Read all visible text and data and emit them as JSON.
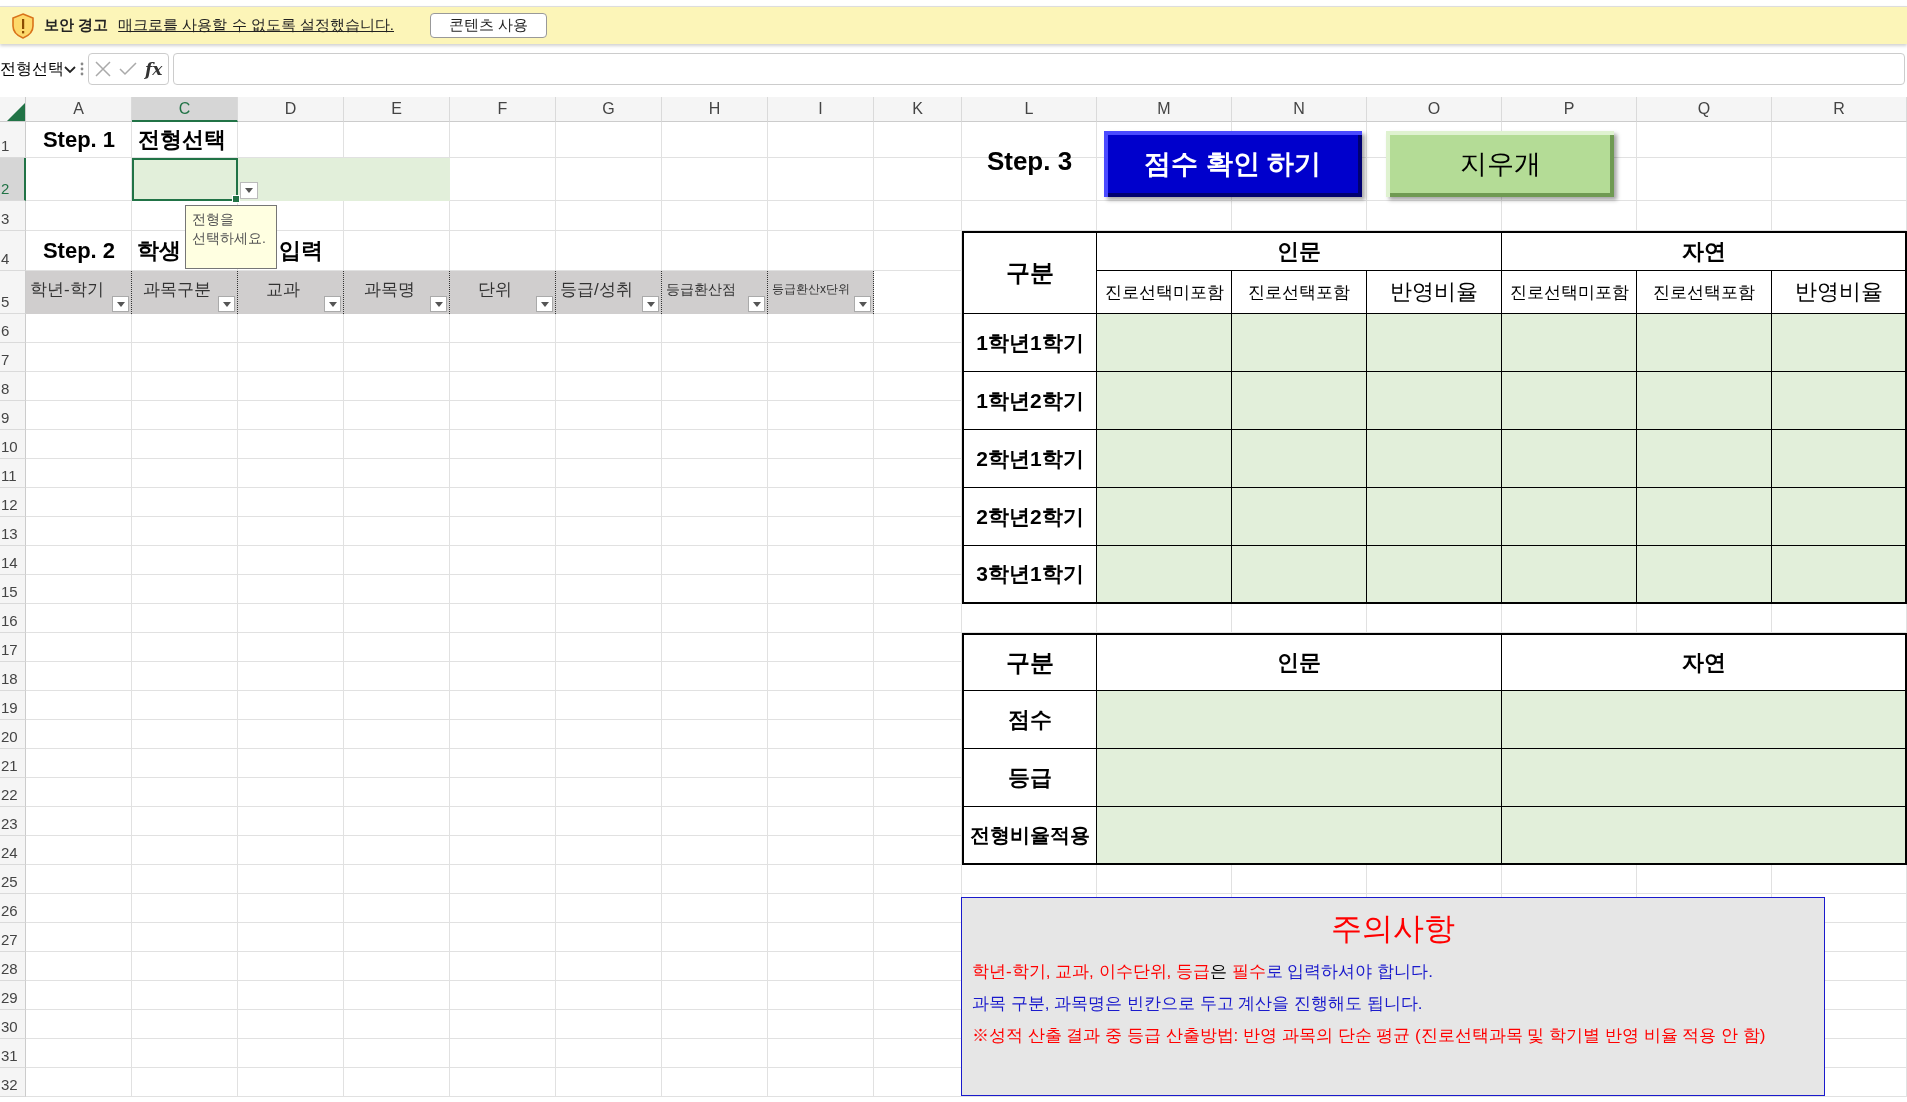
{
  "security_bar": {
    "title": "보안 경고",
    "message": "매크로를 사용할 수 없도록 설정했습니다.",
    "button": "콘텐츠 사용"
  },
  "formula_bar": {
    "name_box": "전형선택",
    "function_button": "fx"
  },
  "column_headers": [
    {
      "label": "A",
      "selected": false
    },
    {
      "label": "C",
      "selected": true
    },
    {
      "label": "D",
      "selected": false
    },
    {
      "label": "E",
      "selected": false
    },
    {
      "label": "F",
      "selected": false
    },
    {
      "label": "G",
      "selected": false
    },
    {
      "label": "H",
      "selected": false
    },
    {
      "label": "I",
      "selected": false
    },
    {
      "label": "K",
      "selected": false
    },
    {
      "label": "L",
      "selected": false
    },
    {
      "label": "M",
      "selected": false
    },
    {
      "label": "N",
      "selected": false
    },
    {
      "label": "O",
      "selected": false
    },
    {
      "label": "P",
      "selected": false
    },
    {
      "label": "Q",
      "selected": false
    },
    {
      "label": "R",
      "selected": false
    }
  ],
  "row_headers": [
    {
      "label": "1",
      "selected": false
    },
    {
      "label": "2",
      "selected": true
    },
    {
      "label": "3",
      "selected": false
    },
    {
      "label": "4",
      "selected": false
    },
    {
      "label": "5",
      "selected": false
    },
    {
      "label": "6",
      "selected": false
    },
    {
      "label": "7",
      "selected": false
    },
    {
      "label": "8",
      "selected": false
    },
    {
      "label": "9",
      "selected": false
    },
    {
      "label": "10",
      "selected": false
    },
    {
      "label": "11",
      "selected": false
    },
    {
      "label": "12",
      "selected": false
    },
    {
      "label": "13",
      "selected": false
    },
    {
      "label": "14",
      "selected": false
    },
    {
      "label": "15",
      "selected": false
    },
    {
      "label": "16",
      "selected": false
    },
    {
      "label": "17",
      "selected": false
    },
    {
      "label": "18",
      "selected": false
    },
    {
      "label": "19",
      "selected": false
    },
    {
      "label": "20",
      "selected": false
    },
    {
      "label": "21",
      "selected": false
    },
    {
      "label": "22",
      "selected": false
    },
    {
      "label": "23",
      "selected": false
    },
    {
      "label": "24",
      "selected": false
    },
    {
      "label": "25",
      "selected": false
    },
    {
      "label": "26",
      "selected": false
    },
    {
      "label": "27",
      "selected": false
    },
    {
      "label": "28",
      "selected": false
    },
    {
      "label": "29",
      "selected": false
    },
    {
      "label": "30",
      "selected": false
    },
    {
      "label": "31",
      "selected": false
    },
    {
      "label": "32",
      "selected": false
    }
  ],
  "step1": {
    "label": "Step. 1",
    "title": "전형선택"
  },
  "tooltip": "전형을 선택하세요.",
  "step2": {
    "label": "Step. 2",
    "title_start": "학생",
    "title_end": "입력",
    "columns": [
      "학년-학기",
      "과목구분",
      "교과",
      "과목명",
      "단위",
      "등급/성취",
      "등급환산점",
      "등급환산x단위"
    ]
  },
  "step3": {
    "label": "Step. 3",
    "buttons": [
      {
        "label": "점수 확인 하기",
        "kind": "primary"
      },
      {
        "label": "지우개",
        "kind": "secondary"
      }
    ]
  },
  "semester_table": {
    "corner": "구분",
    "groups": [
      "인문",
      "자연"
    ],
    "subcolumns": [
      "진로선택미포함",
      "진로선택포함",
      "반영비율",
      "진로선택미포함",
      "진로선택포함",
      "반영비율"
    ],
    "rows": [
      "1학년1학기",
      "1학년2학기",
      "2학년1학기",
      "2학년2학기",
      "3학년1학기"
    ]
  },
  "summary_table": {
    "corner": "구분",
    "groups": [
      "인문",
      "자연"
    ],
    "rows": [
      "점수",
      "등급",
      "전형비율적용"
    ]
  },
  "notice": {
    "title": "주의사항",
    "lines": [
      {
        "segments": [
          {
            "text": "학년-학기, 교과, 이수단위, 등급",
            "color": "#ff0000"
          },
          {
            "text": "은 ",
            "color": "#000000"
          },
          {
            "text": "필수",
            "color": "#ff0000"
          },
          {
            "text": "로 입력하셔야 합니다.",
            "color": "#1a1acc"
          }
        ]
      },
      {
        "segments": [
          {
            "text": "과목 구분, 과목명은 빈칸으로 두고 계산을 진행해도 됩니다.",
            "color": "#1a1acc"
          }
        ]
      },
      {
        "segments": [
          {
            "text": "※성적 산출 결과 중 등급 산출방법: 반영 과목의 단순 평균 (진로선택과목 및 학기별 반영 비율 적용 안 함)",
            "color": "#ff0000"
          }
        ]
      }
    ]
  }
}
